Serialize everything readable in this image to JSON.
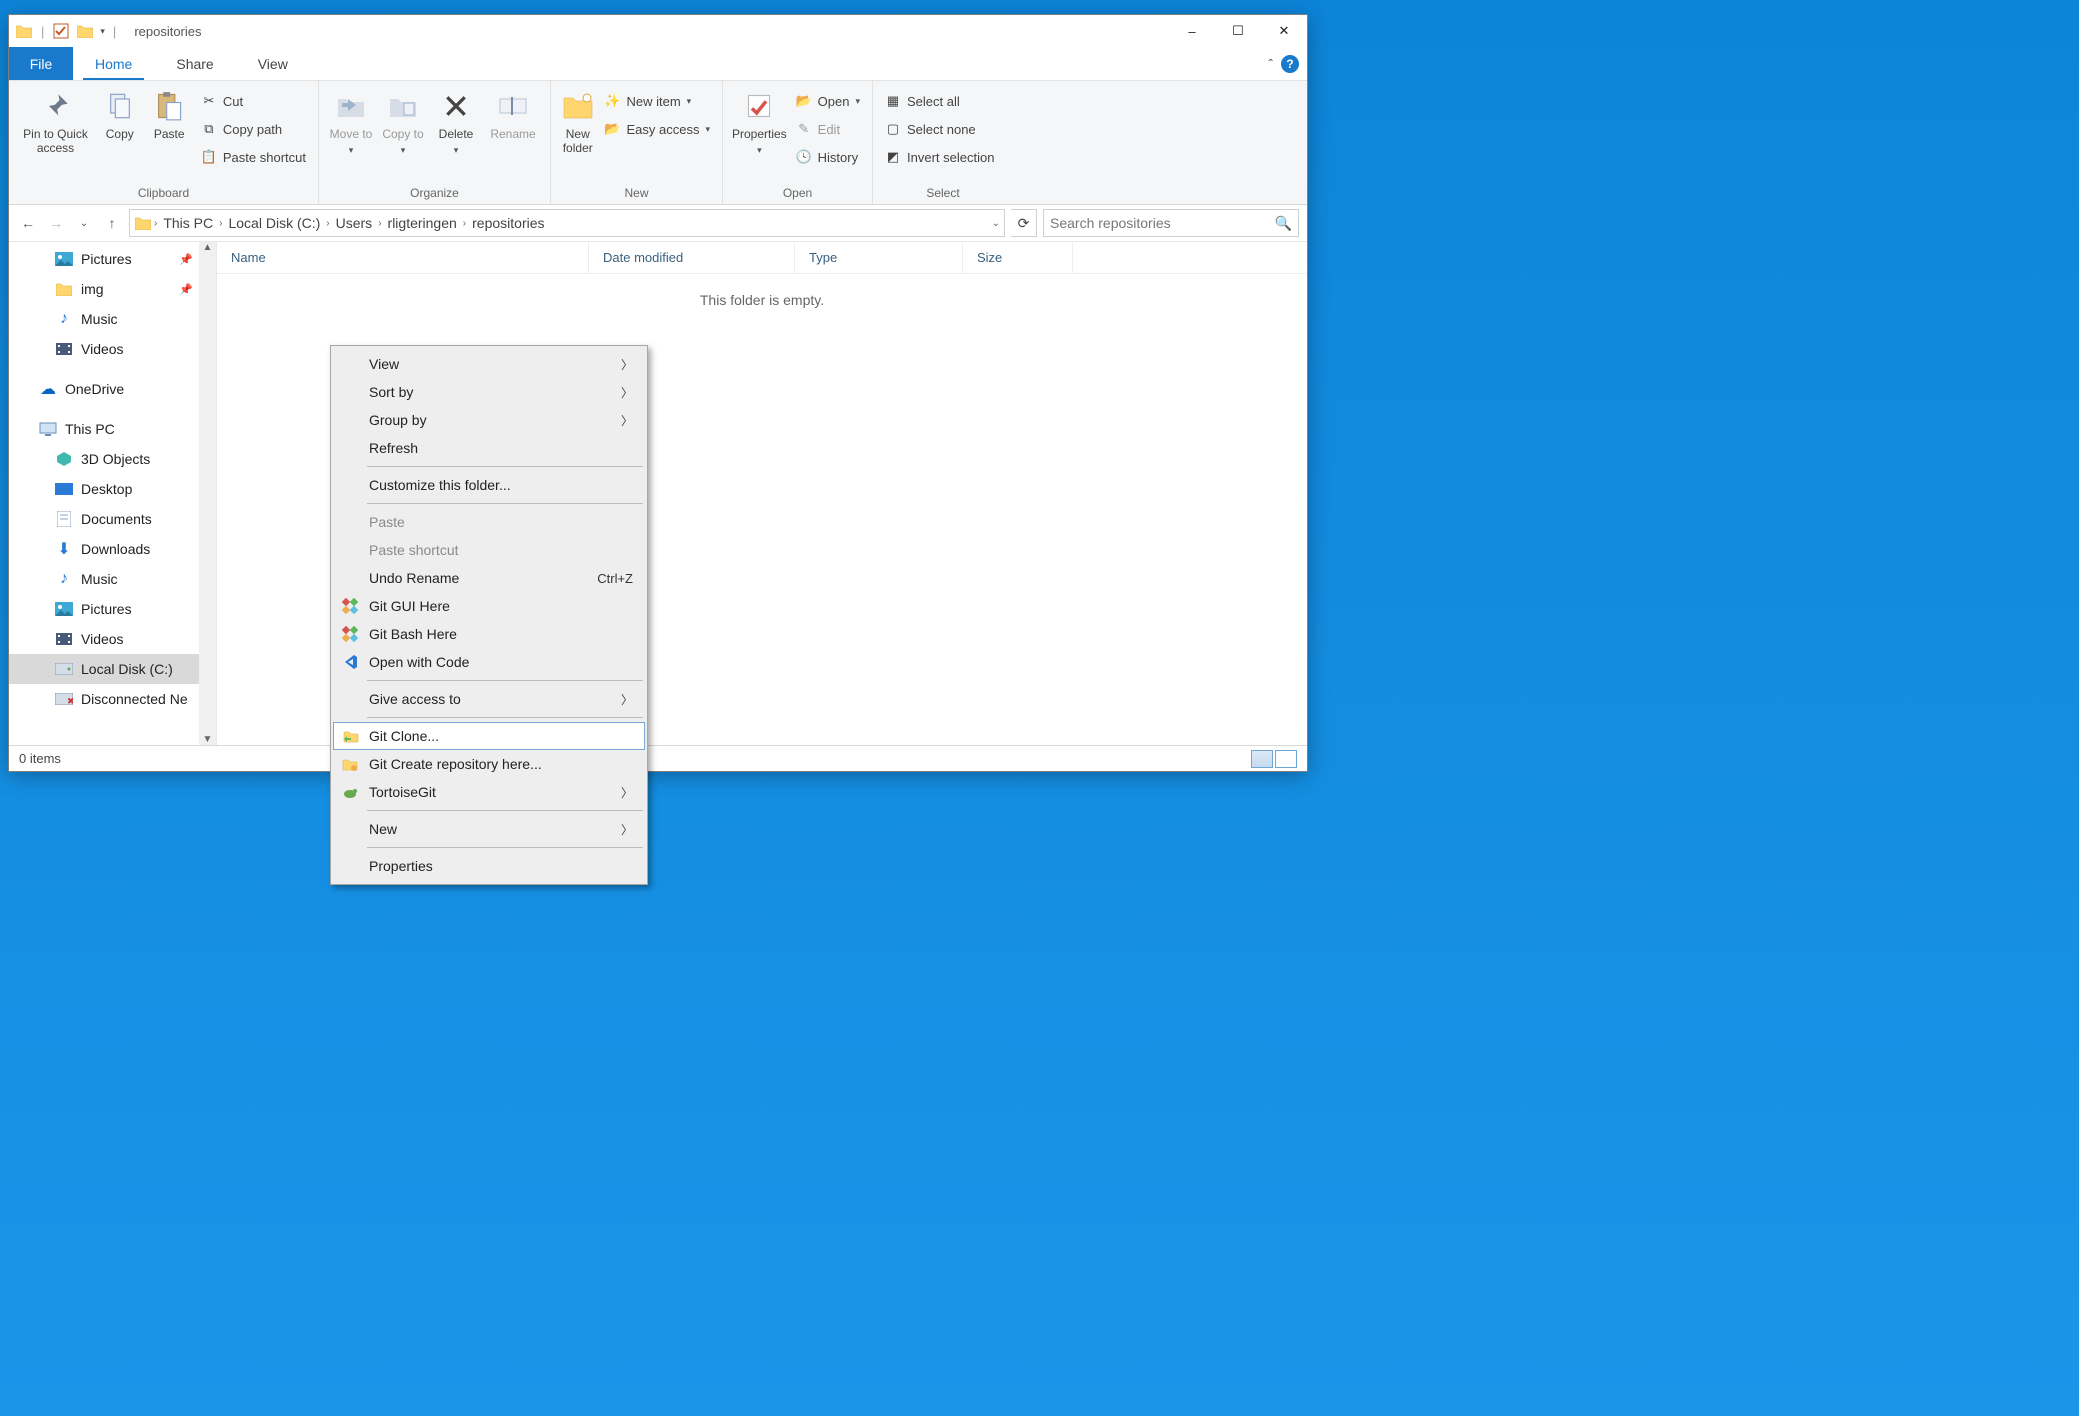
{
  "window": {
    "title": "repositories",
    "controls": {
      "minimize": "–",
      "maximize": "☐",
      "close": "✕"
    }
  },
  "tabs": {
    "file": "File",
    "items": [
      "Home",
      "Share",
      "View"
    ],
    "active": "Home"
  },
  "ribbon": {
    "clipboard": {
      "label": "Clipboard",
      "pin": "Pin to Quick access",
      "copy": "Copy",
      "paste": "Paste",
      "cut": "Cut",
      "copy_path": "Copy path",
      "paste_shortcut": "Paste shortcut"
    },
    "organize": {
      "label": "Organize",
      "move_to": "Move to",
      "copy_to": "Copy to",
      "delete": "Delete",
      "rename": "Rename"
    },
    "new": {
      "label": "New",
      "new_folder": "New folder",
      "new_item": "New item",
      "easy_access": "Easy access"
    },
    "open": {
      "label": "Open",
      "properties": "Properties",
      "open": "Open",
      "edit": "Edit",
      "history": "History"
    },
    "select": {
      "label": "Select",
      "select_all": "Select all",
      "select_none": "Select none",
      "invert": "Invert selection"
    }
  },
  "breadcrumb": {
    "segments": [
      "This PC",
      "Local Disk (C:)",
      "Users",
      "rligteringen",
      "repositories"
    ]
  },
  "search": {
    "placeholder": "Search repositories"
  },
  "columns": {
    "name": "Name",
    "date": "Date modified",
    "type": "Type",
    "size": "Size"
  },
  "empty_message": "This folder is empty.",
  "sidebar": {
    "items": [
      {
        "icon": "pictures",
        "label": "Pictures",
        "pinned": true,
        "indent": 1
      },
      {
        "icon": "folder",
        "label": "img",
        "pinned": true,
        "indent": 1
      },
      {
        "icon": "music",
        "label": "Music",
        "pinned": false,
        "indent": 1
      },
      {
        "icon": "videos",
        "label": "Videos",
        "pinned": false,
        "indent": 1
      },
      {
        "icon": "onedrive",
        "label": "OneDrive",
        "pinned": false,
        "indent": 0
      },
      {
        "icon": "thispc",
        "label": "This PC",
        "pinned": false,
        "indent": 0
      },
      {
        "icon": "3d",
        "label": "3D Objects",
        "pinned": false,
        "indent": 1
      },
      {
        "icon": "desktop",
        "label": "Desktop",
        "pinned": false,
        "indent": 1
      },
      {
        "icon": "documents",
        "label": "Documents",
        "pinned": false,
        "indent": 1
      },
      {
        "icon": "downloads",
        "label": "Downloads",
        "pinned": false,
        "indent": 1
      },
      {
        "icon": "music",
        "label": "Music",
        "pinned": false,
        "indent": 1
      },
      {
        "icon": "pictures",
        "label": "Pictures",
        "pinned": false,
        "indent": 1
      },
      {
        "icon": "videos",
        "label": "Videos",
        "pinned": false,
        "indent": 1
      },
      {
        "icon": "disk",
        "label": "Local Disk (C:)",
        "pinned": false,
        "indent": 1,
        "selected": true
      },
      {
        "icon": "netdrive",
        "label": "Disconnected Ne",
        "pinned": false,
        "indent": 1
      }
    ]
  },
  "status": {
    "item_count": "0 items"
  },
  "context_menu": {
    "items": [
      {
        "label": "View",
        "submenu": true
      },
      {
        "label": "Sort by",
        "submenu": true
      },
      {
        "label": "Group by",
        "submenu": true
      },
      {
        "label": "Refresh"
      },
      {
        "sep": true
      },
      {
        "label": "Customize this folder..."
      },
      {
        "sep": true
      },
      {
        "label": "Paste",
        "disabled": true
      },
      {
        "label": "Paste shortcut",
        "disabled": true
      },
      {
        "label": "Undo Rename",
        "shortcut": "Ctrl+Z"
      },
      {
        "label": "Git GUI Here",
        "icon": "git"
      },
      {
        "label": "Git Bash Here",
        "icon": "git"
      },
      {
        "label": "Open with Code",
        "icon": "vscode"
      },
      {
        "sep": true
      },
      {
        "label": "Give access to",
        "submenu": true
      },
      {
        "sep": true
      },
      {
        "label": "Git Clone...",
        "icon": "gitclone",
        "hover": true
      },
      {
        "label": "Git Create repository here...",
        "icon": "gitcreate"
      },
      {
        "label": "TortoiseGit",
        "icon": "tortoise",
        "submenu": true
      },
      {
        "sep": true
      },
      {
        "label": "New",
        "submenu": true
      },
      {
        "sep": true
      },
      {
        "label": "Properties"
      }
    ]
  }
}
